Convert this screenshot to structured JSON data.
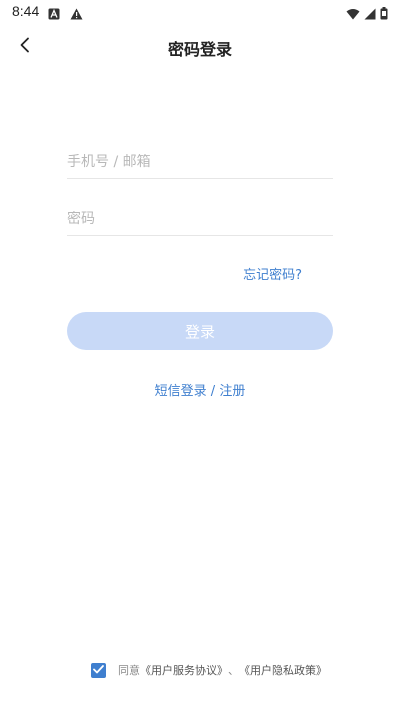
{
  "status_bar": {
    "time": "8:44",
    "icons": [
      "a-notification-icon",
      "warning-icon",
      "wifi-icon",
      "signal-icon",
      "battery-icon"
    ]
  },
  "header": {
    "title": "密码登录",
    "back_icon": "chevron-left-icon"
  },
  "form": {
    "phone_placeholder": "手机号 / 邮箱",
    "password_placeholder": "密码",
    "forgot_password": "忘记密码?",
    "login_button": "登录",
    "sms_login": "短信登录",
    "separator": " / ",
    "register": "注册"
  },
  "agreement": {
    "checked": true,
    "prefix": "同意",
    "user_agreement": "《用户服务协议》",
    "joiner": "、",
    "privacy_policy": "《用户隐私政策》"
  },
  "colors": {
    "accent": "#3f7fcf",
    "button_disabled": "#c8d9f7"
  }
}
